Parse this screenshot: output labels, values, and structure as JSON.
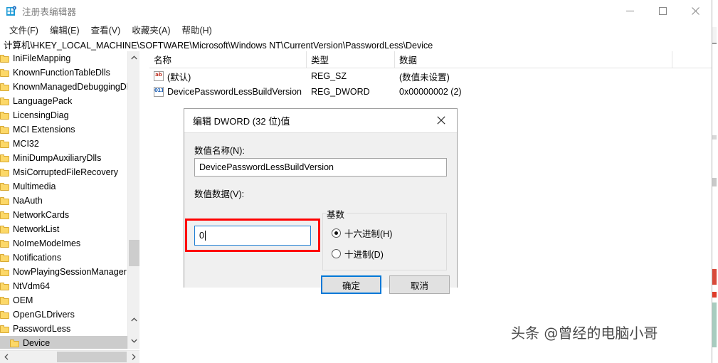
{
  "window": {
    "title": "注册表编辑器",
    "icon": "registry-editor-icon",
    "controls": {
      "minimize": "minimize-icon",
      "maximize": "maximize-icon",
      "close": "close-icon"
    }
  },
  "menubar": {
    "items": [
      {
        "label": "文件(F)"
      },
      {
        "label": "编辑(E)"
      },
      {
        "label": "查看(V)"
      },
      {
        "label": "收藏夹(A)"
      },
      {
        "label": "帮助(H)"
      }
    ]
  },
  "address": {
    "path": "计算机\\HKEY_LOCAL_MACHINE\\SOFTWARE\\Microsoft\\Windows NT\\CurrentVersion\\PasswordLess\\Device"
  },
  "tree": {
    "items": [
      {
        "label": "IniFileMapping",
        "selected": false,
        "indent": 0
      },
      {
        "label": "KnownFunctionTableDlls",
        "selected": false,
        "indent": 0
      },
      {
        "label": "KnownManagedDebuggingDlls",
        "selected": false,
        "indent": 0
      },
      {
        "label": "LanguagePack",
        "selected": false,
        "indent": 0
      },
      {
        "label": "LicensingDiag",
        "selected": false,
        "indent": 0
      },
      {
        "label": "MCI Extensions",
        "selected": false,
        "indent": 0
      },
      {
        "label": "MCI32",
        "selected": false,
        "indent": 0
      },
      {
        "label": "MiniDumpAuxiliaryDlls",
        "selected": false,
        "indent": 0
      },
      {
        "label": "MsiCorruptedFileRecovery",
        "selected": false,
        "indent": 0
      },
      {
        "label": "Multimedia",
        "selected": false,
        "indent": 0
      },
      {
        "label": "NaAuth",
        "selected": false,
        "indent": 0
      },
      {
        "label": "NetworkCards",
        "selected": false,
        "indent": 0
      },
      {
        "label": "NetworkList",
        "selected": false,
        "indent": 0
      },
      {
        "label": "NoImeModeImes",
        "selected": false,
        "indent": 0
      },
      {
        "label": "Notifications",
        "selected": false,
        "indent": 0
      },
      {
        "label": "NowPlayingSessionManager",
        "selected": false,
        "indent": 0
      },
      {
        "label": "NtVdm64",
        "selected": false,
        "indent": 0
      },
      {
        "label": "OEM",
        "selected": false,
        "indent": 0
      },
      {
        "label": "OpenGLDrivers",
        "selected": false,
        "indent": 0
      },
      {
        "label": "PasswordLess",
        "selected": false,
        "indent": 0
      },
      {
        "label": "Device",
        "selected": true,
        "indent": 1
      }
    ]
  },
  "list": {
    "columns": [
      {
        "label": "名称"
      },
      {
        "label": "类型"
      },
      {
        "label": "数据"
      }
    ],
    "rows": [
      {
        "name": "(默认)",
        "type": "REG_SZ",
        "data": "(数值未设置)",
        "icon": "string-value-icon",
        "icon_text": "ab"
      },
      {
        "name": "DevicePasswordLessBuildVersion",
        "type": "REG_DWORD",
        "data": "0x00000002 (2)",
        "icon": "dword-value-icon",
        "icon_text": "011"
      }
    ]
  },
  "dialog": {
    "title": "编辑 DWORD (32 位)值",
    "close_icon": "close-icon",
    "value_name_label": "数值名称(N):",
    "value_name": "DevicePasswordLessBuildVersion",
    "value_data_label": "数值数据(V):",
    "value_data": "0",
    "base_group_label": "基数",
    "radios": [
      {
        "label": "十六进制(H)",
        "checked": true
      },
      {
        "label": "十进制(D)",
        "checked": false
      }
    ],
    "ok_label": "确定",
    "cancel_label": "取消",
    "highlight_color": "#ff0000",
    "accent_color": "#0078d7"
  },
  "watermark": {
    "text": "头条 @曾经的电脑小哥"
  }
}
